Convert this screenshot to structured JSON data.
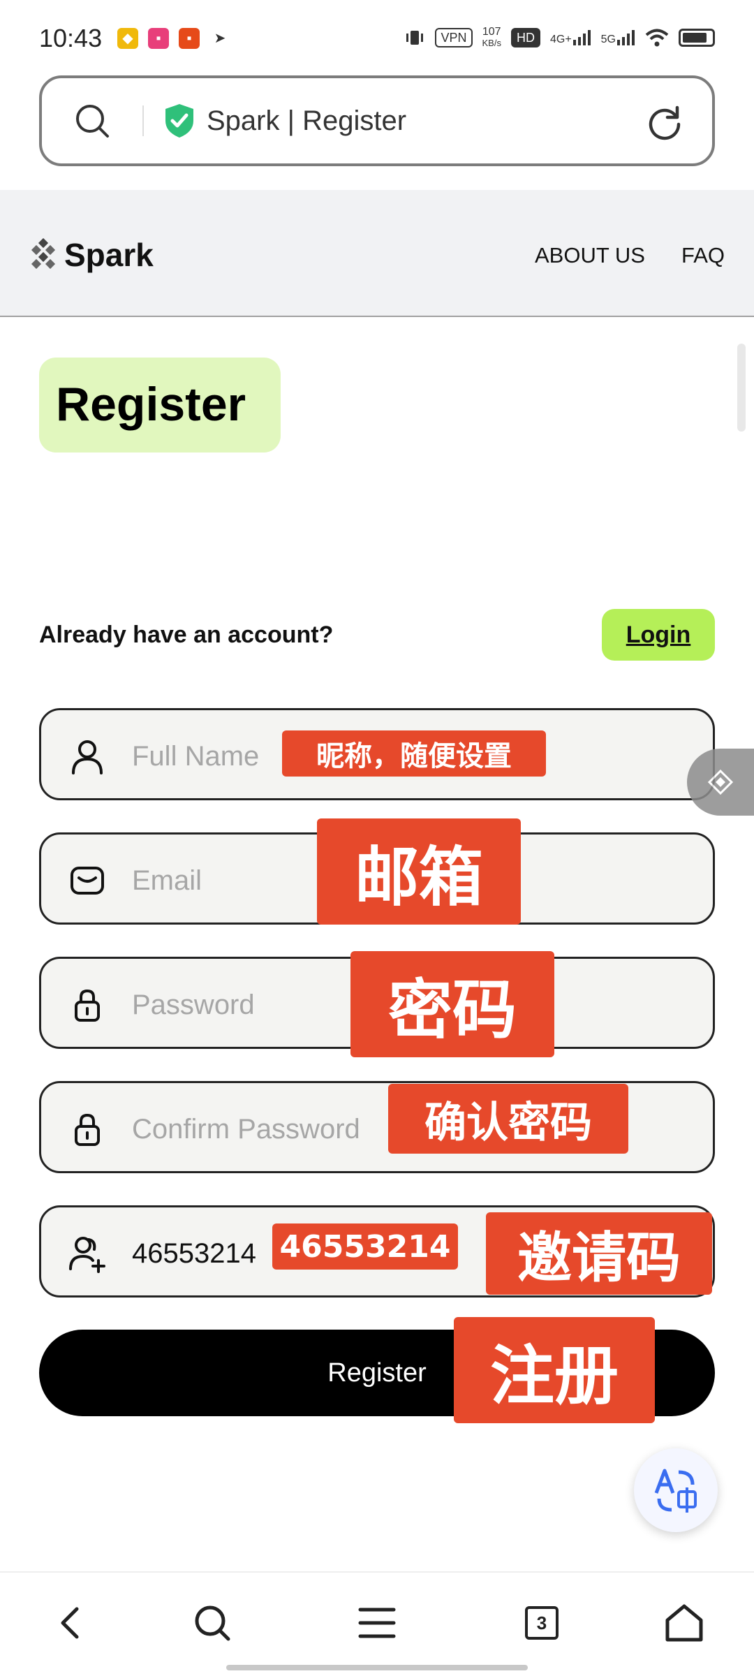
{
  "status_bar": {
    "time": "10:43",
    "vpn": "VPN",
    "net_speed_value": "107",
    "net_speed_unit": "KB/s",
    "hd": "HD",
    "net_4g": "4G+",
    "net_5g": "5G"
  },
  "browser": {
    "page_title": "Spark | Register",
    "tab_count": "3"
  },
  "header": {
    "brand": "Spark",
    "nav": [
      "ABOUT US",
      "FAQ"
    ]
  },
  "form": {
    "heading": "Register",
    "already_text": "Already have an account?",
    "login_label": "Login",
    "full_name_placeholder": "Full Name",
    "email_placeholder": "Email",
    "password_placeholder": "Password",
    "confirm_placeholder": "Confirm Password",
    "invite_value": "46553214",
    "submit_label": "Register"
  },
  "annotations": {
    "nickname": "昵称，随便设置",
    "email": "邮箱",
    "password": "密码",
    "confirm": "确认密码",
    "invite_code_value": "46553214",
    "invite_code": "邀请码",
    "register": "注册"
  },
  "colors": {
    "accent_green": "#b5ef58",
    "badge_green": "#e1f7be",
    "annotation_red": "#e6492b",
    "shield_green": "#2fc07a"
  },
  "icons": {
    "search": "search-icon",
    "shield": "shield-check-icon",
    "reload": "reload-icon",
    "logo": "spark-logo-icon",
    "user": "user-icon",
    "mail": "mail-icon",
    "lock": "lock-icon",
    "invite": "user-plus-icon",
    "translate": "translate-icon",
    "back": "chevron-left-icon",
    "menu": "menu-icon",
    "home": "home-icon"
  }
}
